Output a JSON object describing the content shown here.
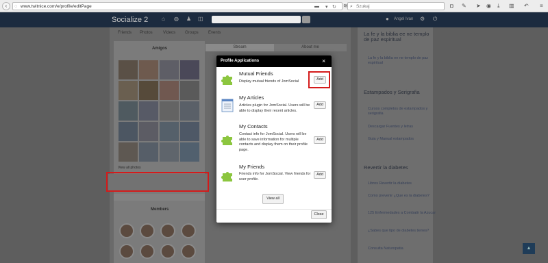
{
  "browser": {
    "url": "www.twitnice.com/e/profile/editPage",
    "search_placeholder": "Szukaj"
  },
  "site": {
    "logo": "Socialize 2",
    "nav_tabs": [
      "Friends",
      "Photos",
      "Videos",
      "Groups",
      "Events"
    ],
    "left_title": "Amigos",
    "stream_tab": "Stream",
    "about_tab": "About me",
    "members_title": "Members",
    "view_all_photos": "View all photos"
  },
  "sidebar": {
    "section1_title": "La fe y la biblia ee ne templo de paz espiritual",
    "section1_link": "La fe y la biblia ee ne templo de paz espiritual",
    "section2_title": "Estampados y Serigrafia",
    "section2_links": [
      "Cursos completos de estampados y serigrafia",
      "Descargar Fuentes y letras",
      "Guia y Manual estampados"
    ],
    "section3_title": "Revertir la diabetes",
    "section3_links": [
      "Libros Revertir la diabetes",
      "Como prevenir ¿Que es la diabetes?",
      "125 Enfermedades a Combatir la Azucar",
      "¿Sabes que tipo de diabetes tienes?",
      "Consulta Naturopatia"
    ]
  },
  "modal": {
    "title": "Profile Applications",
    "close_symbol": "×",
    "apps": [
      {
        "name": "Mutual Friends",
        "description": "Display mutual friends of JomSocial",
        "button": "Add",
        "icon": "puzzle-icon"
      },
      {
        "name": "My Articles",
        "description": "Articles plugin for JomSocial. Users will be able to display their recent articles.",
        "button": "Add",
        "icon": "document-icon"
      },
      {
        "name": "My Contacts",
        "description": "Contact info for JomSocial. Users will be able to save information for multiple contacts and display them on their profile page.",
        "button": "Add",
        "icon": "puzzle-icon"
      },
      {
        "name": "My Friends",
        "description": "Friends info for JomSocial. View friends for user profile.",
        "button": "Add",
        "icon": "puzzle-icon"
      }
    ],
    "view_all": "View all",
    "close": "Close"
  },
  "colors": {
    "annotation_red": "#d41b1b",
    "modal_header": "#000000",
    "puzzle_green": "#8cc63f"
  }
}
